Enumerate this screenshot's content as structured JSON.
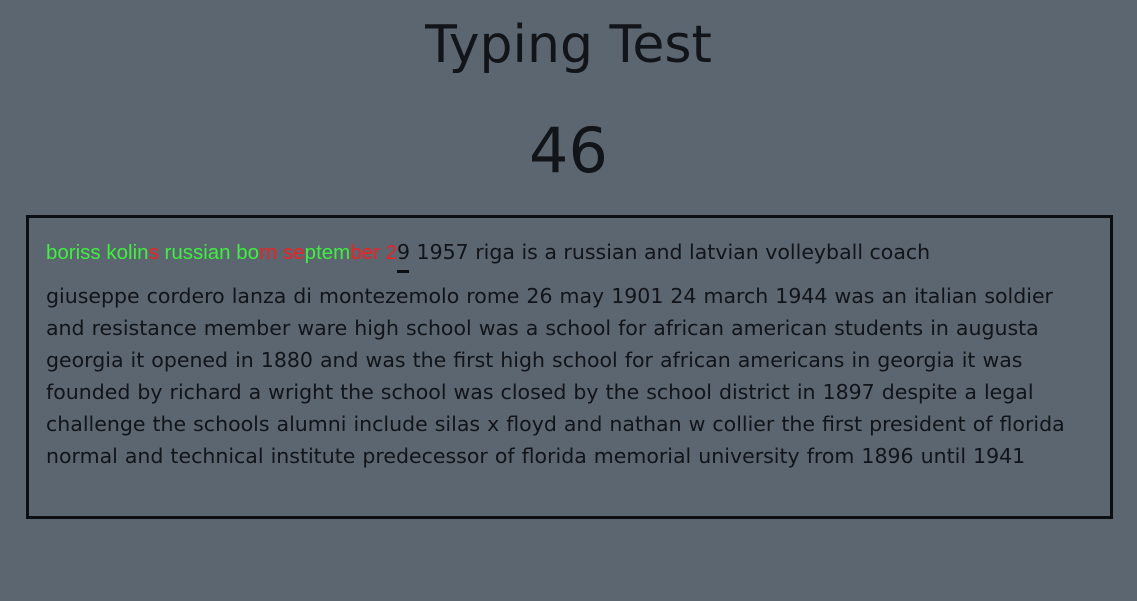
{
  "title": "Typing Test",
  "timer": "46",
  "typing": {
    "typed_segments": [
      {
        "text": "boriss kolin",
        "status": "correct"
      },
      {
        "text": "s",
        "status": "wrong"
      },
      {
        "text": " russian bo",
        "status": "correct"
      },
      {
        "text": "rn",
        "status": "wrong"
      },
      {
        "text": " ",
        "status": "correct"
      },
      {
        "text": "se",
        "status": "wrong"
      },
      {
        "text": "ptem",
        "status": "correct"
      },
      {
        "text": "ber 2",
        "status": "wrong"
      }
    ],
    "cursor_char": "9",
    "line1_remaining": " 1957 riga is a russian and latvian volleyball coach",
    "remaining_text": "giuseppe cordero lanza di montezemolo rome 26 may 1901 24 march 1944 was an italian soldier and resistance member ware high school was a school for african american students in augusta georgia it opened in 1880 and was the first high school for african americans in georgia it was founded by richard a wright the school was closed by the school district in 1897 despite a legal challenge the schools alumni include silas x floyd and nathan w collier the first president of florida normal and technical institute predecessor of florida memorial university from 1896 until 1941"
  },
  "colors": {
    "background": "#5c6671",
    "correct": "#3cf23c",
    "wrong": "#f22020",
    "text": "#111418"
  }
}
